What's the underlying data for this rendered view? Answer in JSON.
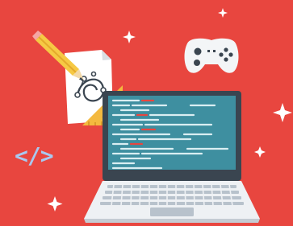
{
  "code_tag": "</>",
  "colors": {
    "background": "#E8463F",
    "laptop_body": "#3A4550",
    "screen": "#3E8FA0",
    "code_line": "#D9EEF2",
    "code_line_accent": "#E8463F",
    "keyboard_deck": "#EEF1F4",
    "keys": "#B8C2CC",
    "pencil": "#F6C944",
    "ruler": "#F4B93F",
    "paper": "#FFFFFF",
    "gamepad": "#F3F5F7",
    "code_tag": "#A9C8F0",
    "sparkle": "#FFFFFF"
  },
  "icons": [
    "pencil-icon",
    "vector-drawing-document-icon",
    "set-square-ruler-icon",
    "gamepad-icon",
    "code-tag-icon",
    "laptop-icon",
    "sparkle-icon"
  ]
}
